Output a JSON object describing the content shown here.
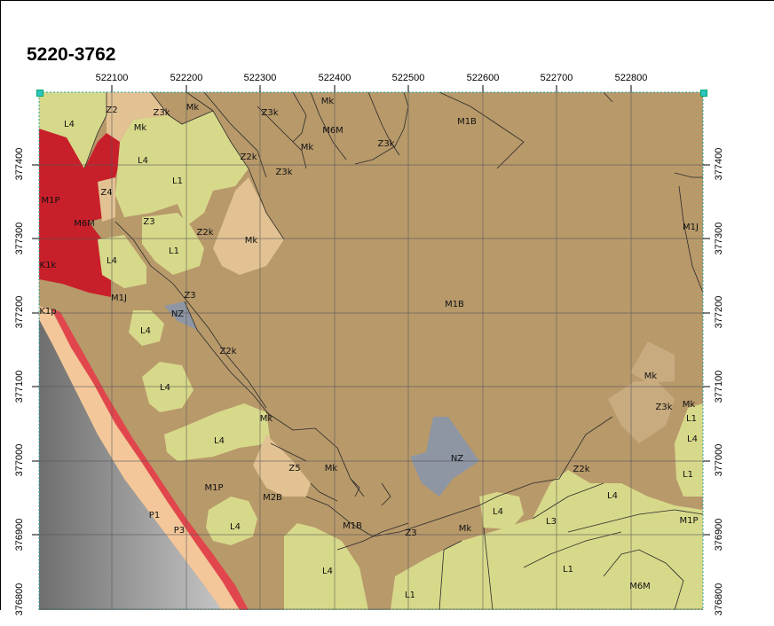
{
  "title": "5220-3762",
  "x_ticks": [
    "522100",
    "522200",
    "522300",
    "522400",
    "522500",
    "522600",
    "522700",
    "522800"
  ],
  "y_ticks_left": [
    "377400",
    "377300",
    "377200",
    "377100",
    "377000",
    "376900",
    "376800"
  ],
  "y_ticks_right": [
    "377400",
    "377300",
    "377200",
    "377100",
    "377000",
    "376900",
    "376800"
  ],
  "legend_colors": {
    "M1B": "#b8996a",
    "L": "#d7d98a",
    "Z": "#e2c293",
    "M1P": "#c8202a",
    "P": "#f3c79a",
    "NZ": "#8e96a4",
    "sea": "#8c8c8c"
  },
  "polygon_labels": [
    {
      "text": "L4",
      "id": "l4-a"
    },
    {
      "text": "Z2",
      "id": "z2-a"
    },
    {
      "text": "Z3k",
      "id": "z3k-a"
    },
    {
      "text": "Mk",
      "id": "mk-a"
    },
    {
      "text": "Z3k",
      "id": "z3k-b"
    },
    {
      "text": "Mk",
      "id": "mk-b"
    },
    {
      "text": "M6M",
      "id": "m6m-a"
    },
    {
      "text": "M1B",
      "id": "m1b-a"
    },
    {
      "text": "Mk",
      "id": "mk-c"
    },
    {
      "text": "Z3k",
      "id": "z3k-c"
    },
    {
      "text": "L4",
      "id": "l4-b"
    },
    {
      "text": "Z2k",
      "id": "z2k-a"
    },
    {
      "text": "Mk",
      "id": "mk-d"
    },
    {
      "text": "Z3k",
      "id": "z3k-d"
    },
    {
      "text": "L1",
      "id": "l1-a"
    },
    {
      "text": "Z4",
      "id": "z4-a"
    },
    {
      "text": "M1P",
      "id": "m1p-a"
    },
    {
      "text": "M6M",
      "id": "m6m-b"
    },
    {
      "text": "Z3",
      "id": "z3-a"
    },
    {
      "text": "Z2k",
      "id": "z2k-b"
    },
    {
      "text": "Mk",
      "id": "mk-e"
    },
    {
      "text": "L1",
      "id": "l1-b"
    },
    {
      "text": "M1J",
      "id": "m1j-a"
    },
    {
      "text": "K1k",
      "id": "k1k-a"
    },
    {
      "text": "L4",
      "id": "l4-c"
    },
    {
      "text": "Z3",
      "id": "z3-b"
    },
    {
      "text": "M1J",
      "id": "m1j-b"
    },
    {
      "text": "NZ",
      "id": "nz-a"
    },
    {
      "text": "K1p",
      "id": "k1p-a"
    },
    {
      "text": "M1B",
      "id": "m1b-b"
    },
    {
      "text": "L4",
      "id": "l4-d"
    },
    {
      "text": "Z2k",
      "id": "z2k-c"
    },
    {
      "text": "L4",
      "id": "l4-e"
    },
    {
      "text": "Mk",
      "id": "mk-f"
    },
    {
      "text": "Z3k",
      "id": "z3k-e"
    },
    {
      "text": "Mk",
      "id": "mk-g"
    },
    {
      "text": "L1",
      "id": "l1-c"
    },
    {
      "text": "Mk",
      "id": "mk-h"
    },
    {
      "text": "L4",
      "id": "l4-f"
    },
    {
      "text": "L4",
      "id": "l4-g"
    },
    {
      "text": "NZ",
      "id": "nz-b"
    },
    {
      "text": "Z5",
      "id": "z5-a"
    },
    {
      "text": "Mk",
      "id": "mk-i"
    },
    {
      "text": "Z2k",
      "id": "z2k-d"
    },
    {
      "text": "L1",
      "id": "l1-d"
    },
    {
      "text": "M1P",
      "id": "m1p-b"
    },
    {
      "text": "M2B",
      "id": "m2b-a"
    },
    {
      "text": "L4",
      "id": "l4-h"
    },
    {
      "text": "L4",
      "id": "l4-i"
    },
    {
      "text": "L3",
      "id": "l3-a"
    },
    {
      "text": "M1P",
      "id": "m1p-c"
    },
    {
      "text": "P1",
      "id": "p1-a"
    },
    {
      "text": "L4",
      "id": "l4-j"
    },
    {
      "text": "M1B",
      "id": "m1b-c"
    },
    {
      "text": "Z3",
      "id": "z3-c"
    },
    {
      "text": "Mk",
      "id": "mk-j"
    },
    {
      "text": "P3",
      "id": "p3-a"
    },
    {
      "text": "L4",
      "id": "l4-k"
    },
    {
      "text": "L1",
      "id": "l1-e"
    },
    {
      "text": "L1",
      "id": "l1-f"
    },
    {
      "text": "M6M",
      "id": "m6m-c"
    }
  ]
}
